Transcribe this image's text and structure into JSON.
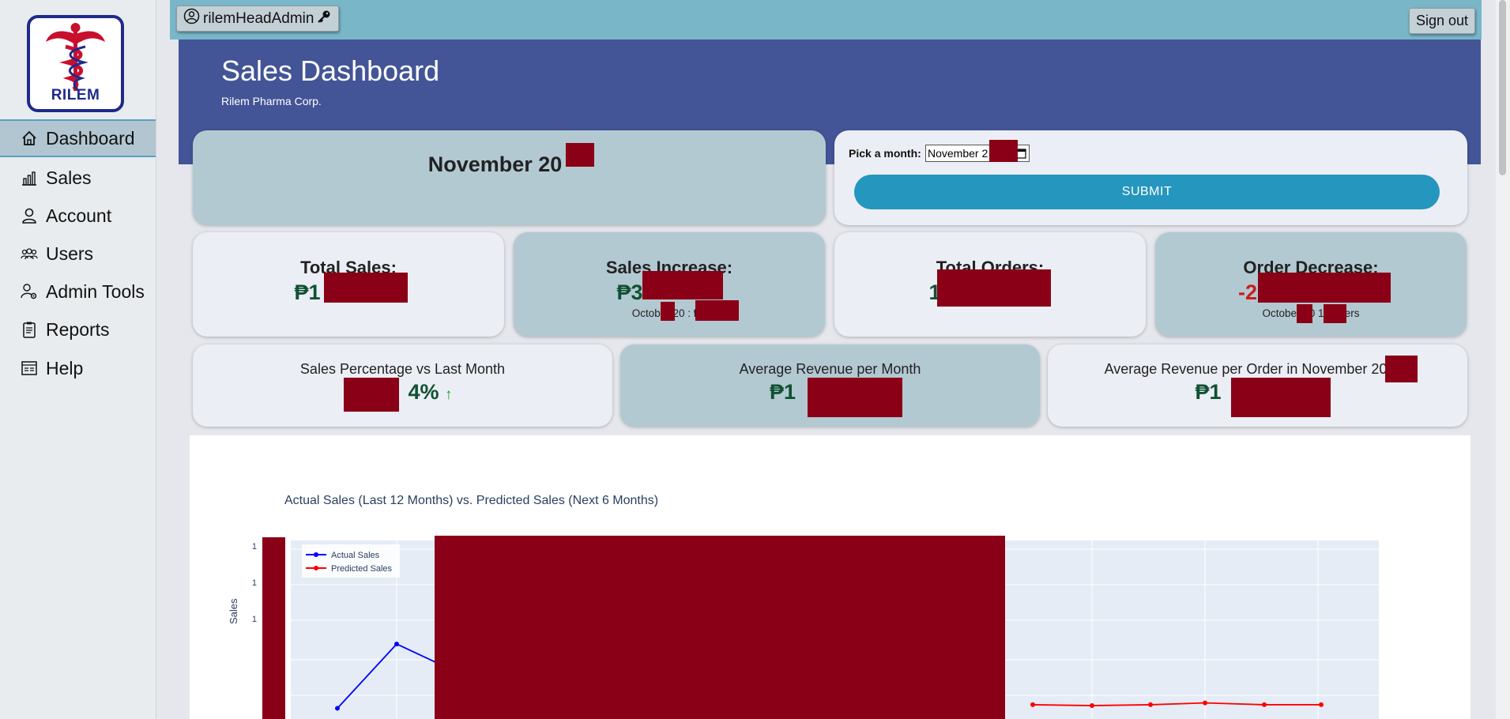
{
  "sidebar": {
    "logo_text": "RILEM",
    "items": [
      {
        "label": "Dashboard",
        "icon": "home-icon",
        "active": true
      },
      {
        "label": "Sales",
        "icon": "bar-chart-icon"
      },
      {
        "label": "Account",
        "icon": "person-icon"
      },
      {
        "label": "Users",
        "icon": "people-icon"
      },
      {
        "label": "Admin Tools",
        "icon": "admin-gear-icon"
      },
      {
        "label": "Reports",
        "icon": "clipboard-icon"
      },
      {
        "label": "Help",
        "icon": "help-card-icon"
      }
    ]
  },
  "topbar": {
    "username": "rilemHeadAdmin",
    "user_icon": "user-circle-icon",
    "key_icon": "key-icon",
    "signout_label": "Sign out"
  },
  "header": {
    "title": "Sales Dashboard",
    "subtitle": "Rilem Pharma Corp."
  },
  "period_card": {
    "month_label": "November 20"
  },
  "picker": {
    "label": "Pick a month:",
    "value": "November 2",
    "submit_label": "SUBMIT"
  },
  "stats": [
    {
      "title": "Total Sales:",
      "value": "₱1",
      "note": ""
    },
    {
      "title": "Sales Increase:",
      "value": "₱3",
      "note": "October 20   : ₱1"
    },
    {
      "title": "Total Orders:",
      "value": "1",
      "note": ""
    },
    {
      "title": "Order Decrease:",
      "value": "-2",
      "note": "October 20     1   Orders"
    }
  ],
  "metrics": [
    {
      "title": "Sales Percentage vs Last Month",
      "value": "4%",
      "trend": "↑"
    },
    {
      "title": "Average Revenue per Month",
      "value": "₱1"
    },
    {
      "title": "Average Revenue per Order in November 20",
      "value": "₱1"
    }
  ],
  "chart_data": {
    "type": "line",
    "title": "Actual Sales (Last 12 Months) vs. Predicted Sales (Next 6 Months)",
    "ylabel": "Sales",
    "legend": "top-left",
    "grid": true,
    "ytick_labels": [
      "1",
      "1",
      "1"
    ],
    "series": [
      {
        "name": "Actual Sales",
        "color": "#0000ff",
        "values": [
          0.06,
          0.42,
          0.3
        ]
      },
      {
        "name": "Predicted Sales",
        "color": "#ff0000",
        "values": [
          0.08,
          0.075,
          0.08,
          0.09,
          0.08,
          0.08
        ]
      }
    ]
  },
  "colors": {
    "hero": "#435597",
    "topbar": "#79b6c8",
    "submit": "#2596be",
    "positive": "#0f5132",
    "negative": "#d01b1b"
  }
}
